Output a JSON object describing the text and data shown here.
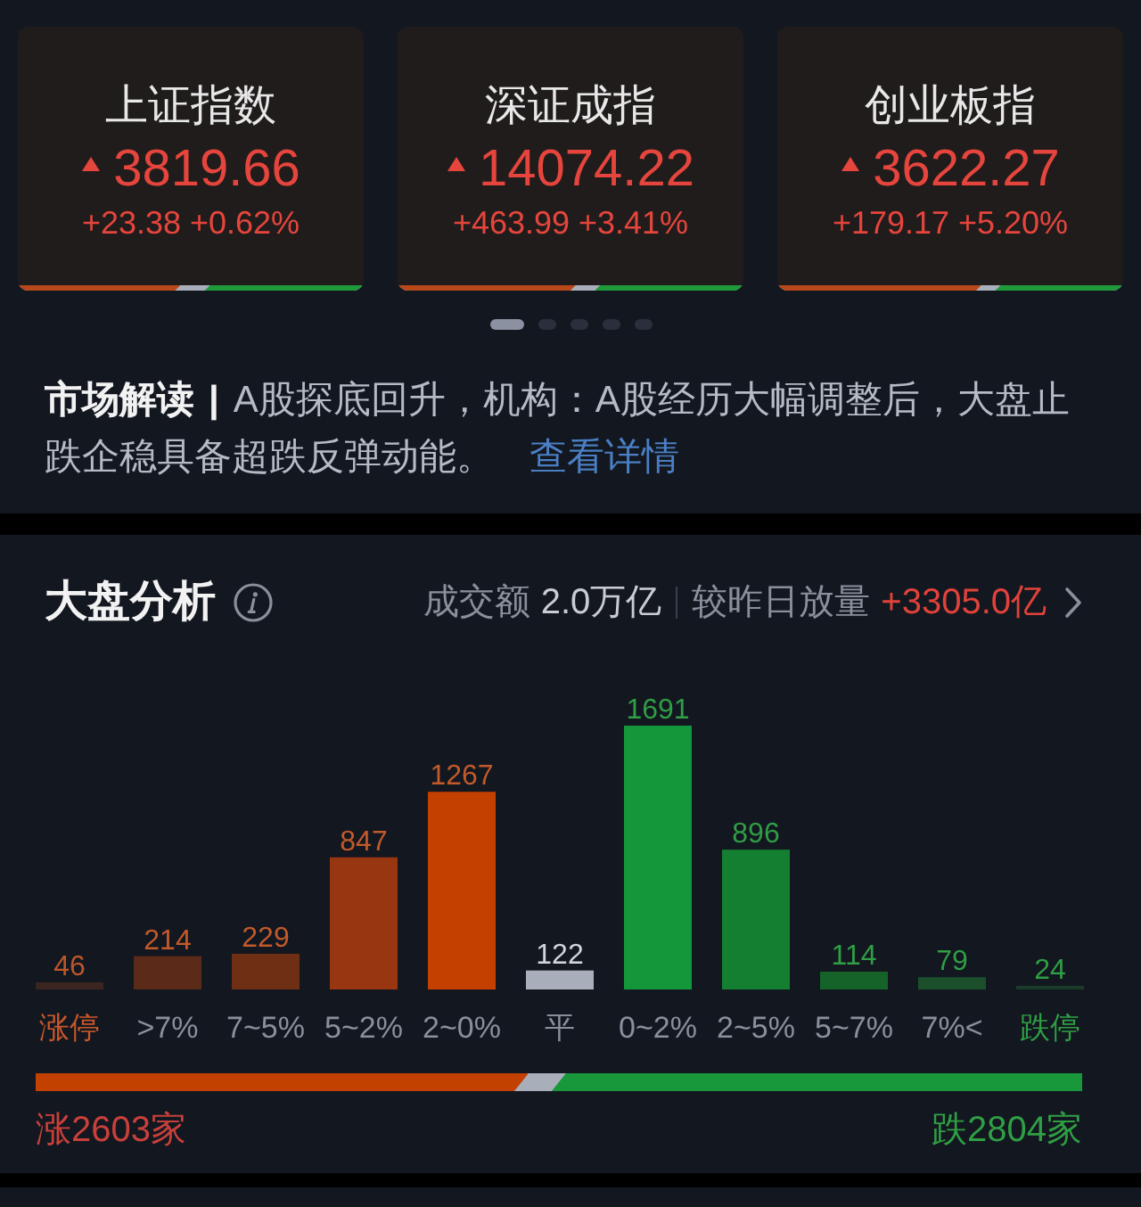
{
  "index_cards": [
    {
      "name": "上证指数",
      "rising": true,
      "value": "3819.66",
      "change": "+23.38 +0.62%",
      "breadth": {
        "rise": {
          "level": 0.47
        },
        "fall": {
          "level": 0.46
        }
      }
    },
    {
      "name": "深证成指",
      "rising": true,
      "value": "14074.22",
      "change": "+463.99 +3.41%",
      "breadth": {
        "rise": {
          "level": 0.515
        },
        "fall": {
          "level": 0.43
        }
      }
    },
    {
      "name": "创业板指",
      "rising": true,
      "value": "3622.27",
      "change": "+179.17 +5.20%",
      "breadth": {
        "rise": {
          "level": 0.59
        },
        "fall": {
          "level": 0.37
        }
      }
    }
  ],
  "pages": [
    {
      "selected": true
    },
    {
      "selected": false
    },
    {
      "selected": false
    },
    {
      "selected": false
    },
    {
      "selected": false
    }
  ],
  "commentary": {
    "label": "市场解读",
    "separator": "|",
    "text": "A股探底回升，机构：A股经历大幅调整后，大盘止跌企稳具备超跌反弹动能。",
    "link": "查看详情"
  },
  "analysis": {
    "title": "大盘分析",
    "turnover_label": "成交额",
    "turnover_value": "2.0万亿",
    "volume_label": "较昨日放量",
    "volume_change": "+3305.0亿",
    "chart_data": {
      "type": "bar",
      "categories": [
        "涨停",
        ">7%",
        "7~5%",
        "5~2%",
        "2~0%",
        "平",
        "0~2%",
        "2~5%",
        "5~7%",
        "7%<",
        "跌停"
      ],
      "values": [
        46,
        214,
        229,
        847,
        1267,
        122,
        1691,
        896,
        114,
        79,
        24
      ],
      "data_labels": true,
      "colors": [
        "#3b2520",
        "#5b2a19",
        "#6f2f15",
        "#983612",
        "#c44000",
        "#a9aebb",
        "#14963a",
        "#147f30",
        "#166329",
        "#1b4f2b",
        "#1b3b2a"
      ]
    },
    "bar_styles": [
      {
        "kind": "limit_up"
      },
      {
        "kind": "up"
      },
      {
        "kind": "up"
      },
      {
        "kind": "up"
      },
      {
        "kind": "up"
      },
      {
        "kind": "flat"
      },
      {
        "kind": "down"
      },
      {
        "kind": "down"
      },
      {
        "kind": "down"
      },
      {
        "kind": "down"
      },
      {
        "kind": "limit_down"
      }
    ],
    "breadth": {
      "rise": {
        "level": 0.471
      },
      "fall": {
        "level": 0.507
      },
      "up_label": "涨2603家",
      "down_label": "跌2804家"
    }
  }
}
